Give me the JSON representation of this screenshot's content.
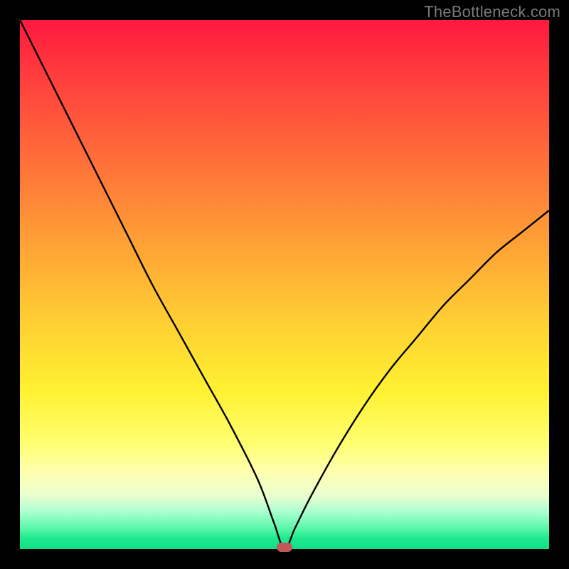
{
  "watermark": "TheBottleneck.com",
  "colors": {
    "frame": "#000000",
    "curve": "#000000",
    "marker": "#c25858",
    "gradient_top": "#ff183f",
    "gradient_bottom": "#0fdf86"
  },
  "chart_data": {
    "type": "line",
    "title": "",
    "xlabel": "",
    "ylabel": "",
    "xlim": [
      0,
      100
    ],
    "ylim": [
      0,
      100
    ],
    "x": [
      0,
      5,
      10,
      15,
      20,
      25,
      30,
      35,
      40,
      45,
      48,
      50,
      52,
      55,
      60,
      65,
      70,
      75,
      80,
      85,
      90,
      95,
      100
    ],
    "values": [
      100,
      90,
      80,
      70,
      60,
      50,
      41,
      32,
      23,
      13,
      5,
      0,
      4,
      10,
      19,
      27,
      34,
      40,
      46,
      51,
      56,
      60,
      64
    ],
    "marker": {
      "x": 50,
      "y": 0
    },
    "notes": "V-shaped bottleneck curve; minimum at x≈50, y=0. Background is a vertical gradient encoding bottleneck severity (red=high, green=low)."
  }
}
